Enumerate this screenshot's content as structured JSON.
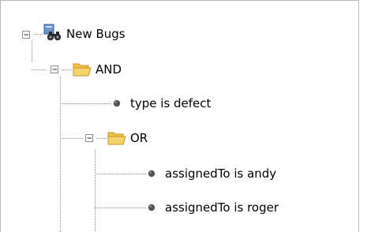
{
  "tree": {
    "root": {
      "label": "New Bugs",
      "icon": "query-binoculars-icon",
      "expanded": true
    },
    "and_node": {
      "label": "AND",
      "icon": "folder-open-icon",
      "expanded": true
    },
    "type_leaf": {
      "label": "type is defect",
      "icon": "bullet-icon"
    },
    "or_node": {
      "label": "OR",
      "icon": "folder-open-icon",
      "expanded": true
    },
    "andy_leaf": {
      "label": "assignedTo is andy",
      "icon": "bullet-icon"
    },
    "roger_leaf": {
      "label": "assignedTo is roger",
      "icon": "bullet-icon"
    }
  },
  "colors": {
    "folder": "#f3c24a",
    "folder_dark": "#c9961d",
    "connector": "#8a8a8a",
    "bullet": "#555555",
    "border": "#b9b9b9"
  }
}
